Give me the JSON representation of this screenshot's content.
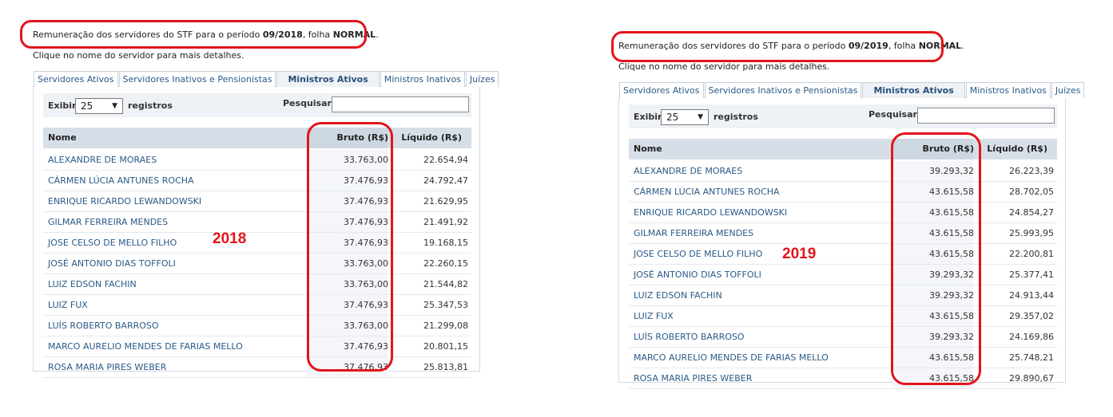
{
  "panels": [
    {
      "info": {
        "prefix": "Remuneração dos servidores do STF para o período ",
        "period": "09/2018",
        "mid": ", folha ",
        "folha": "NORMAL",
        "suffix": "."
      },
      "hint": "Clique no nome do servidor para mais detalhes.",
      "tabs": [
        "Servidores Ativos",
        "Servidores Inativos e Pensionistas",
        "Ministros Ativos",
        "Ministros Inativos",
        "Juízes"
      ],
      "active_tab": 2,
      "controls": {
        "exibir": "Exibir",
        "page_size": "25",
        "registros": "registros",
        "pesquisar": "Pesquisar:"
      },
      "columns": {
        "nome": "Nome",
        "bruto": "Bruto (R$)",
        "liquido": "Líquido (R$)"
      },
      "rows": [
        {
          "nome": "ALEXANDRE DE MORAES",
          "bruto": "33.763,00",
          "liquido": "22.654,94"
        },
        {
          "nome": "CÁRMEN LÚCIA ANTUNES ROCHA",
          "bruto": "37.476,93",
          "liquido": "24.792,47"
        },
        {
          "nome": "ENRIQUE RICARDO LEWANDOWSKI",
          "bruto": "37.476,93",
          "liquido": "21.629,95"
        },
        {
          "nome": "GILMAR FERREIRA MENDES",
          "bruto": "37.476,93",
          "liquido": "21.491,92"
        },
        {
          "nome": "JOSE CELSO DE MELLO FILHO",
          "bruto": "37.476,93",
          "liquido": "19.168,15"
        },
        {
          "nome": "JOSÉ ANTONIO DIAS TOFFOLI",
          "bruto": "33.763,00",
          "liquido": "22.260,15"
        },
        {
          "nome": "LUIZ EDSON FACHIN",
          "bruto": "33.763,00",
          "liquido": "21.544,82"
        },
        {
          "nome": "LUIZ FUX",
          "bruto": "37.476,93",
          "liquido": "25.347,53"
        },
        {
          "nome": "LUÍS ROBERTO BARROSO",
          "bruto": "33.763,00",
          "liquido": "21.299,08"
        },
        {
          "nome": "MARCO AURELIO MENDES DE FARIAS MELLO",
          "bruto": "37.476,93",
          "liquido": "20.801,15"
        },
        {
          "nome": "ROSA MARIA PIRES WEBER",
          "bruto": "37.476,93",
          "liquido": "25.813,81"
        }
      ],
      "year_label": "2018"
    },
    {
      "info": {
        "prefix": "Remuneração dos servidores do STF para o período ",
        "period": "09/2019",
        "mid": ", folha ",
        "folha": "NORMAL",
        "suffix": "."
      },
      "hint": "Clique no nome do servidor para mais detalhes.",
      "tabs": [
        "Servidores Ativos",
        "Servidores Inativos e Pensionistas",
        "Ministros Ativos",
        "Ministros Inativos",
        "Juízes"
      ],
      "active_tab": 2,
      "controls": {
        "exibir": "Exibir",
        "page_size": "25",
        "registros": "registros",
        "pesquisar": "Pesquisar:"
      },
      "columns": {
        "nome": "Nome",
        "bruto": "Bruto (R$)",
        "liquido": "Líquido (R$)"
      },
      "rows": [
        {
          "nome": "ALEXANDRE DE MORAES",
          "bruto": "39.293,32",
          "liquido": "26.223,39"
        },
        {
          "nome": "CÁRMEN LÚCIA ANTUNES ROCHA",
          "bruto": "43.615,58",
          "liquido": "28.702,05"
        },
        {
          "nome": "ENRIQUE RICARDO LEWANDOWSKI",
          "bruto": "43.615,58",
          "liquido": "24.854,27"
        },
        {
          "nome": "GILMAR FERREIRA MENDES",
          "bruto": "43.615,58",
          "liquido": "25.993,95"
        },
        {
          "nome": "JOSE CELSO DE MELLO FILHO",
          "bruto": "43.615,58",
          "liquido": "22.200,81"
        },
        {
          "nome": "JOSÉ ANTONIO DIAS TOFFOLI",
          "bruto": "39.293,32",
          "liquido": "25.377,41"
        },
        {
          "nome": "LUIZ EDSON FACHIN",
          "bruto": "39.293,32",
          "liquido": "24.913,44"
        },
        {
          "nome": "LUIZ FUX",
          "bruto": "43.615,58",
          "liquido": "29.357,02"
        },
        {
          "nome": "LUÍS ROBERTO BARROSO",
          "bruto": "39.293,32",
          "liquido": "24.169,86"
        },
        {
          "nome": "MARCO AURELIO MENDES DE FARIAS MELLO",
          "bruto": "43.615,58",
          "liquido": "25.748,21"
        },
        {
          "nome": "ROSA MARIA PIRES WEBER",
          "bruto": "43.615,58",
          "liquido": "29.890,67"
        }
      ],
      "year_label": "2019"
    }
  ],
  "annotation_color": "#e3141b"
}
